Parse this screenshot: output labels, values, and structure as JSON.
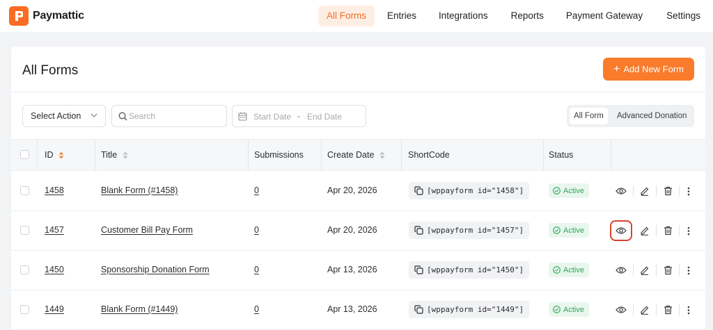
{
  "brand": {
    "name": "Paymattic"
  },
  "nav": {
    "items": [
      {
        "label": "All Forms",
        "active": true
      },
      {
        "label": "Entries"
      },
      {
        "label": "Integrations"
      },
      {
        "label": "Reports"
      },
      {
        "label": "Payment Gateway"
      },
      {
        "label": "Settings"
      }
    ]
  },
  "page": {
    "title": "All Forms",
    "add_button": "Add New Form"
  },
  "filters": {
    "select_action": "Select Action",
    "search_placeholder": "Search",
    "start_date_placeholder": "Start Date",
    "date_separator": "-",
    "end_date_placeholder": "End Date",
    "type_tabs": [
      {
        "label": "All Form",
        "active": true
      },
      {
        "label": "Advanced Donation"
      }
    ]
  },
  "table": {
    "headers": {
      "id": "ID",
      "title": "Title",
      "submissions": "Submissions",
      "create_date": "Create Date",
      "shortcode": "ShortCode",
      "status": "Status"
    },
    "rows": [
      {
        "id": "1458",
        "title": "Blank Form (#1458)",
        "submissions": "0",
        "date": "Apr 20, 2026",
        "shortcode": "[wppayform id=\"1458\"]",
        "status": "Active"
      },
      {
        "id": "1457",
        "title": "Customer Bill Pay Form",
        "submissions": "0",
        "date": "Apr 20, 2026",
        "shortcode": "[wppayform id=\"1457\"]",
        "status": "Active"
      },
      {
        "id": "1450",
        "title": "Sponsorship Donation Form",
        "submissions": "0",
        "date": "Apr 13, 2026",
        "shortcode": "[wppayform id=\"1450\"]",
        "status": "Active"
      },
      {
        "id": "1449",
        "title": "Blank Form (#1449)",
        "submissions": "0",
        "date": "Apr 13, 2026",
        "shortcode": "[wppayform id=\"1449\"]",
        "status": "Active"
      }
    ]
  },
  "colors": {
    "accent": "#fa7b2b",
    "active_status": "#2ea55b",
    "highlight": "#d9432c"
  }
}
